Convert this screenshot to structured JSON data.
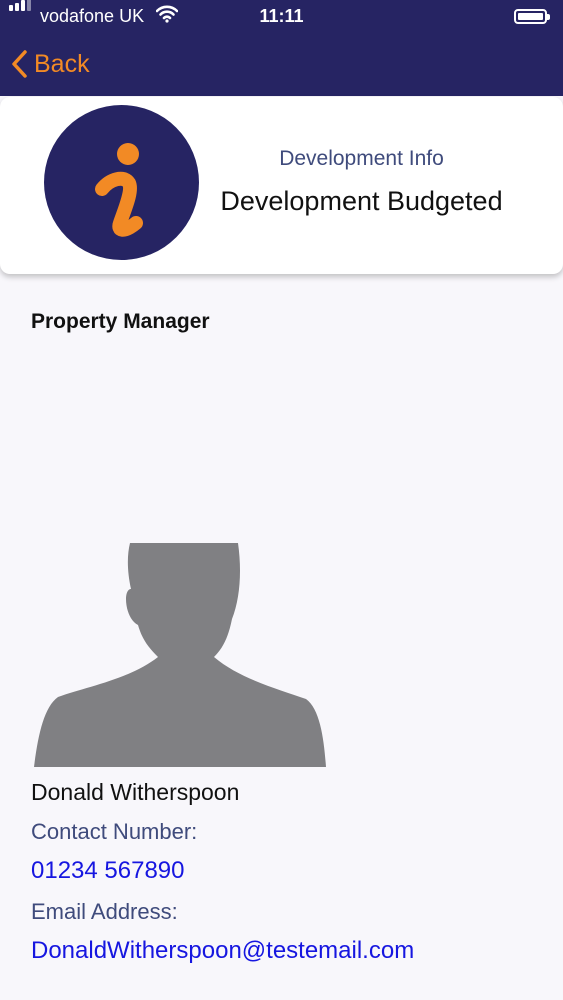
{
  "status_bar": {
    "carrier": "vodafone UK",
    "time": "11:11",
    "icons": [
      "signal-icon",
      "wifi-icon",
      "battery-icon"
    ]
  },
  "nav": {
    "back_label": "Back",
    "accent_color": "#f28a25",
    "bar_color": "#262463"
  },
  "header_card": {
    "icon": "info-icon",
    "subtitle": "Development Info",
    "title": "Development Budgeted"
  },
  "section": {
    "title": "Property Manager"
  },
  "manager": {
    "photo": "person-silhouette-icon",
    "name": "Donald Witherspoon",
    "contact_label": "Contact Number:",
    "phone": "01234 567890",
    "email_label": "Email Address:",
    "email": "DonaldWitherspoon@testemail.com",
    "link_color": "#1616e0"
  }
}
